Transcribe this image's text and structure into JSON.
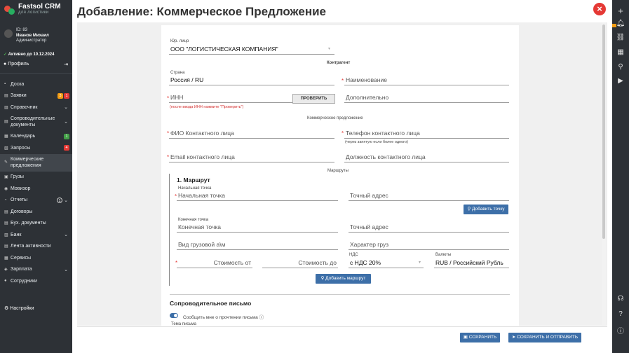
{
  "app": {
    "logo_title": "Fastsol CRM",
    "logo_sub": "для логистики"
  },
  "user": {
    "id": "ID: 83",
    "name": "Иванов Михаил",
    "role": "Администратор",
    "active": "Активно до 10.12.2024",
    "profile": "Профиль"
  },
  "menu": [
    {
      "label": "Доска",
      "icon": "board-icon"
    },
    {
      "label": "Заявки",
      "icon": "requests-icon",
      "badges": [
        "3",
        "1"
      ]
    },
    {
      "label": "Справочник",
      "icon": "book-icon",
      "chevron": true
    },
    {
      "label": "Сопроводительные документы",
      "icon": "docs-icon",
      "chevron": true,
      "two": true
    },
    {
      "label": "Календарь",
      "icon": "calendar-icon",
      "badges": [
        "1"
      ]
    },
    {
      "label": "Запросы",
      "icon": "queries-icon",
      "badges": [
        "4"
      ]
    },
    {
      "label": "Коммерческие предложения",
      "icon": "offer-icon",
      "two": true,
      "selected": true
    },
    {
      "label": "Грузы",
      "icon": "cargo-icon"
    },
    {
      "label": "Мовизор",
      "icon": "movizor-icon"
    },
    {
      "label": "Отчеты",
      "icon": "reports-icon",
      "chevron": true,
      "badges": [
        "1"
      ]
    },
    {
      "label": "Договоры",
      "icon": "contracts-icon"
    },
    {
      "label": "Бух. документы",
      "icon": "accounting-icon"
    },
    {
      "label": "Банк",
      "icon": "bank-icon",
      "chevron": true
    },
    {
      "label": "Лента активности",
      "icon": "activity-icon"
    },
    {
      "label": "Сервисы",
      "icon": "services-icon"
    },
    {
      "label": "Зарплата",
      "icon": "salary-icon",
      "chevron": true
    },
    {
      "label": "Сотрудники",
      "icon": "staff-icon"
    }
  ],
  "settings": "Настройки",
  "page": {
    "title": "Добавление: Коммерческое Предложение"
  },
  "form": {
    "legal_label": "Юр. лицо",
    "legal_value": "ООО \"ЛОГИСТИЧЕСКАЯ КОМПАНИЯ\"",
    "contractor_section": "Контрагент",
    "country_label": "Страна",
    "country_value": "Россия / RU",
    "name_placeholder": "Наименование",
    "inn_placeholder": "ИНН",
    "check_button": "ПРОВЕРИТЬ",
    "inn_hint": "(после ввода ИНН нажмите \"Проверить\")",
    "additional_placeholder": "Дополнительно",
    "offer_section": "Коммерческое предложение",
    "contact_name": "ФИО Контактного лица",
    "contact_phone": "Телефон контактного лица",
    "phone_hint": "(через запятую если более одного)",
    "contact_email": "Email контактного лица",
    "contact_position": "Должность контактного лица",
    "routes_section": "Маршруты",
    "route_title": "1. Маршрут",
    "start_label": "Начальная точка",
    "start_placeholder": "Начальная точка",
    "exact_address": "Точный адрес",
    "add_point": "Добавить точку",
    "end_label": "Конечная точка",
    "end_placeholder": "Конечная точка",
    "exact_address2": "Точный адрес",
    "vehicle_type": "Вид грузовой а\\м",
    "cargo_nature": "Характер груз",
    "cost_from": "Стоимость от",
    "cost_to": "Стоимость до",
    "vat_label": "НДС",
    "vat_value": "с НДС 20%",
    "currency_label": "Валюты",
    "currency_value": "RUB / Российский Рубль",
    "add_route": "Добавить маршрут",
    "letter_section": "Сопроводительное письмо",
    "notify_label": "Сообщить мне о прочтении письма",
    "subject_label": "Тема письма"
  },
  "footer": {
    "save": "СОХРАНИТЬ",
    "save_send": "СОХРАНИТЬ И ОТПРАВИТЬ"
  },
  "colors": {
    "sidebar": "#2d3136",
    "accent": "#3d6fa8",
    "danger": "#e53935",
    "badge_orange": "#f39c12",
    "badge_red": "#e53935",
    "badge_green": "#43a047"
  }
}
